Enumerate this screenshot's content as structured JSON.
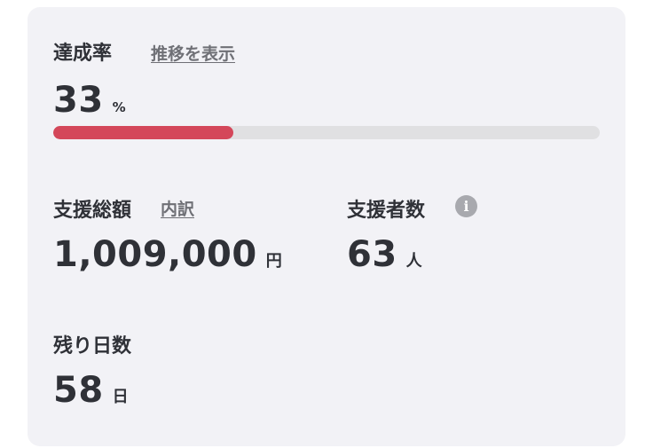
{
  "achievement": {
    "label": "達成率",
    "link": "推移を表示",
    "value": "33",
    "unit": "%",
    "progress_percent": 33,
    "fill_color": "#d4475a",
    "track_color": "#e0e0e2"
  },
  "total": {
    "label": "支援総額",
    "link": "内訳",
    "value": "1,009,000",
    "unit": "円"
  },
  "supporters": {
    "label": "支援者数",
    "info_icon": "i",
    "value": "63",
    "unit": "人"
  },
  "remaining": {
    "label": "残り日数",
    "value": "58",
    "unit": "日"
  }
}
